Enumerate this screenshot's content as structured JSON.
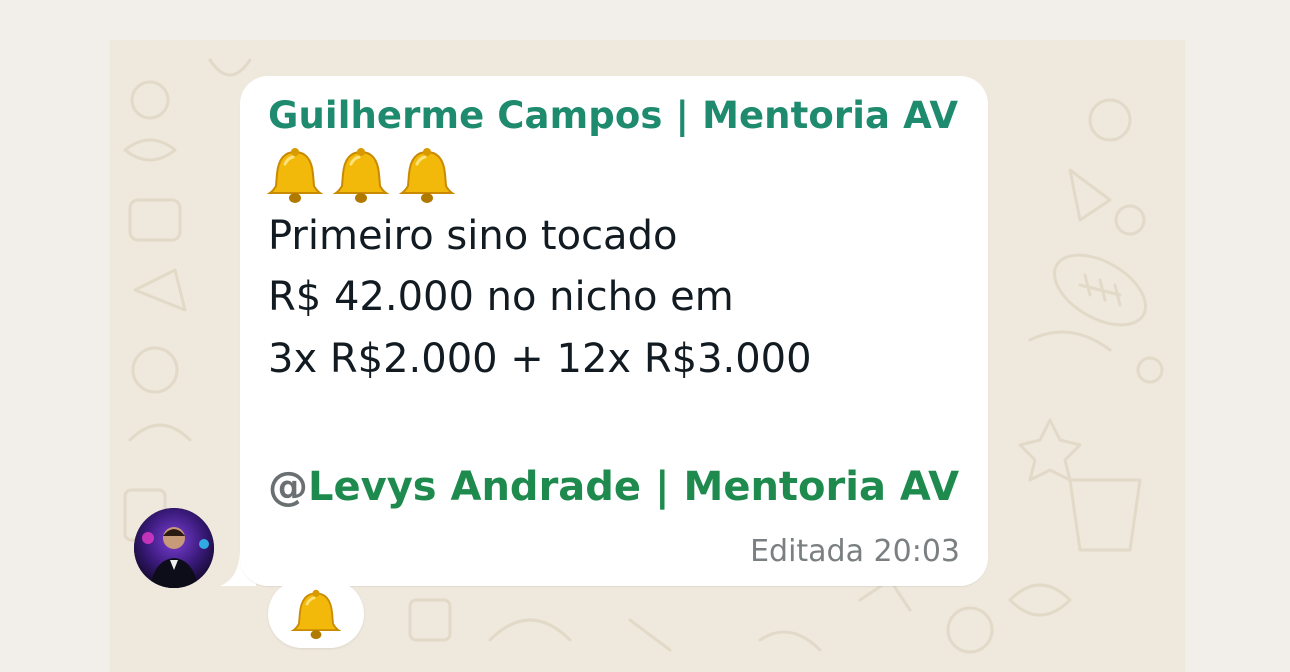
{
  "message": {
    "sender": "Guilherme Campos | Mentoria AV",
    "bell_emoji_count": 3,
    "bell_icon": "bell-icon",
    "lines": [
      "Primeiro sino tocado",
      "R$ 42.000 no nicho em",
      "3x R$2.000 + 12x R$3.000"
    ],
    "mention_at": "@",
    "mention_name": "Levys Andrade | Mentoria AV",
    "edited_label": "Editada",
    "time": "20:03"
  },
  "reaction": {
    "icon": "bell-icon",
    "count": 1
  },
  "colors": {
    "sender": "#1e8a6e",
    "mention": "#1e8a4e",
    "bubble": "#ffffff",
    "wallpaper": "#efe8dc"
  }
}
